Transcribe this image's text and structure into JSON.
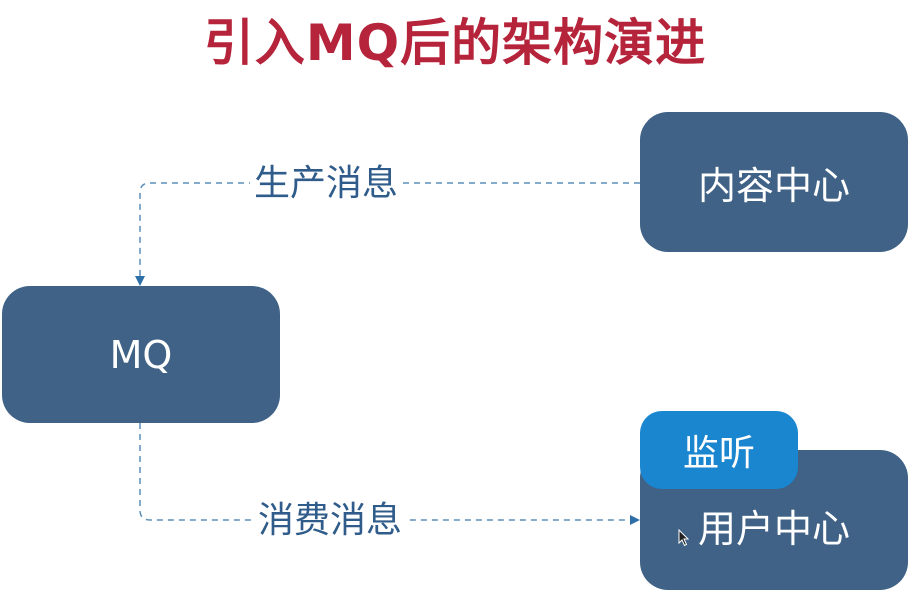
{
  "title": "引入MQ后的架构演进",
  "nodes": {
    "content_center": "内容中心",
    "mq": "MQ",
    "user_center": "用户中心",
    "listen_badge": "监听"
  },
  "edges": {
    "produce_label": "生产消息",
    "consume_label": "消费消息"
  },
  "colors": {
    "title": "#b5243a",
    "node_fill": "#3f6286",
    "badge_fill": "#1a86d0",
    "edge_line": "#5b8fba",
    "edge_label": "#2f5c8a"
  }
}
